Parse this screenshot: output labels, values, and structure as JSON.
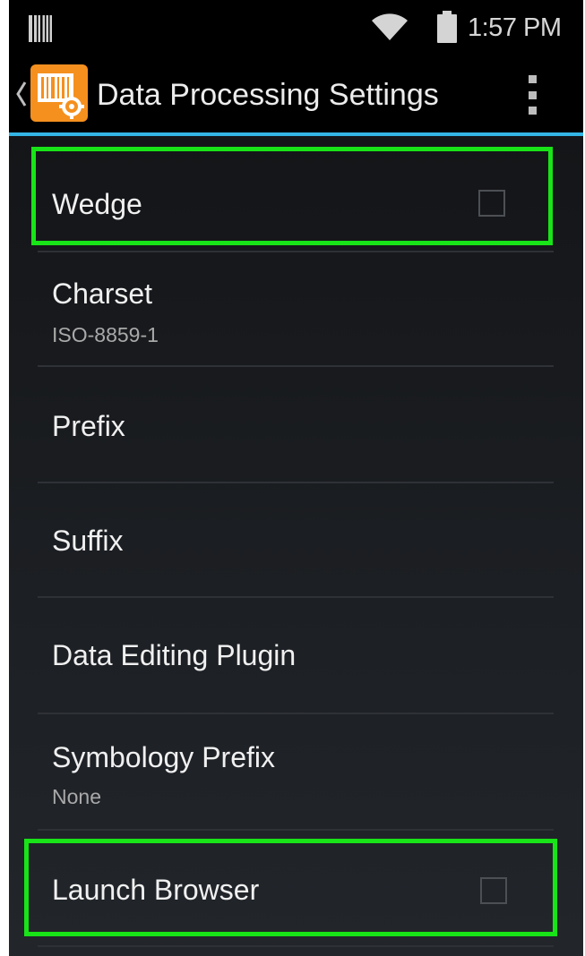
{
  "status_bar": {
    "time": "1:57 PM",
    "icons": [
      "barcode-icon",
      "wifi-icon",
      "battery-icon"
    ]
  },
  "action_bar": {
    "title": "Data Processing Settings",
    "icons": [
      "back-chevron-icon",
      "barcode-settings-app-icon",
      "overflow-menu-icon"
    ],
    "app_icon_color": "#f5901e",
    "accent_color": "#33b5e5"
  },
  "list": {
    "items": [
      {
        "title": "Wedge",
        "summary": "",
        "type": "checkbox",
        "checked": false,
        "highlighted": true
      },
      {
        "title": "Charset",
        "summary": "ISO-8859-1",
        "type": "preference"
      },
      {
        "title": "Prefix",
        "summary": "",
        "type": "preference"
      },
      {
        "title": "Suffix",
        "summary": "",
        "type": "preference"
      },
      {
        "title": "Data Editing Plugin",
        "summary": "",
        "type": "preference"
      },
      {
        "title": "Symbology Prefix",
        "summary": "None",
        "type": "preference"
      },
      {
        "title": "Launch Browser",
        "summary": "",
        "type": "checkbox",
        "checked": false,
        "highlighted": true
      }
    ]
  },
  "highlight_color": "#18e418"
}
